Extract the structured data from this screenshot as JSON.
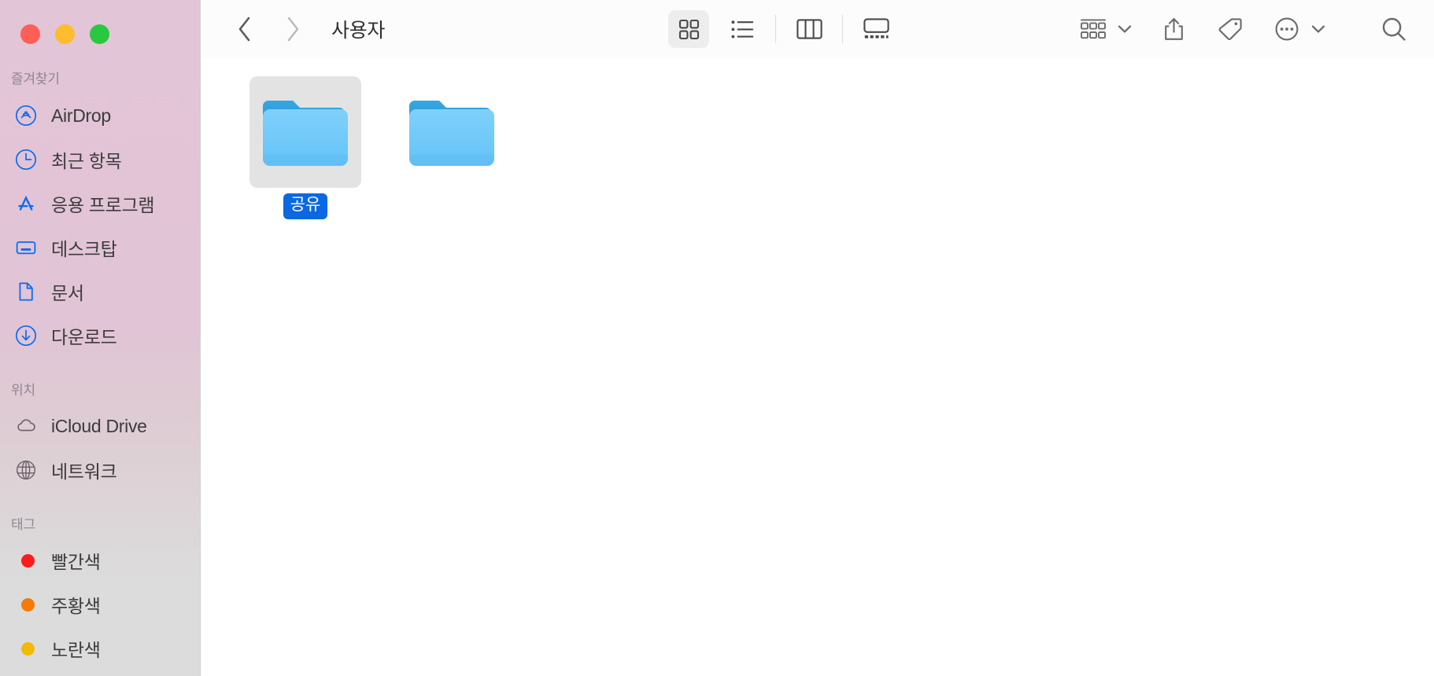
{
  "window": {
    "title": "사용자",
    "traffic_lights": [
      {
        "name": "close",
        "color": "#ff5f57"
      },
      {
        "name": "minimize",
        "color": "#febc2e"
      },
      {
        "name": "maximize",
        "color": "#28c840"
      }
    ]
  },
  "sidebar": {
    "sections": [
      {
        "title": "즐겨찾기",
        "items": [
          {
            "label": "AirDrop",
            "icon": "airdrop-icon",
            "color": "#0a6cf0"
          },
          {
            "label": "최근 항목",
            "icon": "clock-icon",
            "color": "#0a6cf0"
          },
          {
            "label": "응용 프로그램",
            "icon": "app-store-icon",
            "color": "#0a6cf0"
          },
          {
            "label": "데스크탑",
            "icon": "desktop-icon",
            "color": "#0a6cf0"
          },
          {
            "label": "문서",
            "icon": "document-icon",
            "color": "#0a6cf0"
          },
          {
            "label": "다운로드",
            "icon": "download-icon",
            "color": "#0a6cf0"
          }
        ]
      },
      {
        "title": "위치",
        "items": [
          {
            "label": "iCloud Drive",
            "icon": "cloud-icon",
            "color": "#6b6068"
          },
          {
            "label": "네트워크",
            "icon": "globe-icon",
            "color": "#6b6068"
          }
        ]
      },
      {
        "title": "태그",
        "items": [
          {
            "label": "빨간색",
            "icon": "tag-dot-icon",
            "color": "#fc1b1b"
          },
          {
            "label": "주황색",
            "icon": "tag-dot-icon",
            "color": "#f57a08"
          },
          {
            "label": "노란색",
            "icon": "tag-dot-icon",
            "color": "#f2ba05"
          }
        ]
      }
    ]
  },
  "toolbar": {
    "back_label": "뒤로",
    "forward_label": "앞으로",
    "view_modes": [
      {
        "name": "icon-view",
        "label": "아이콘 보기",
        "active": true
      },
      {
        "name": "list-view",
        "label": "목록 보기",
        "active": false
      },
      {
        "name": "column-view",
        "label": "열 보기",
        "active": false
      },
      {
        "name": "gallery-view",
        "label": "갤러리 보기",
        "active": false
      }
    ],
    "actions": [
      {
        "name": "group-by",
        "label": "그룹 사용"
      },
      {
        "name": "share",
        "label": "공유"
      },
      {
        "name": "tags",
        "label": "태그"
      },
      {
        "name": "more",
        "label": "더 보기"
      },
      {
        "name": "search",
        "label": "검색"
      }
    ]
  },
  "content": {
    "items": [
      {
        "label": "공유",
        "selected": true,
        "icon": "folder-icon"
      },
      {
        "label": "",
        "selected": false,
        "icon": "folder-icon"
      }
    ]
  }
}
